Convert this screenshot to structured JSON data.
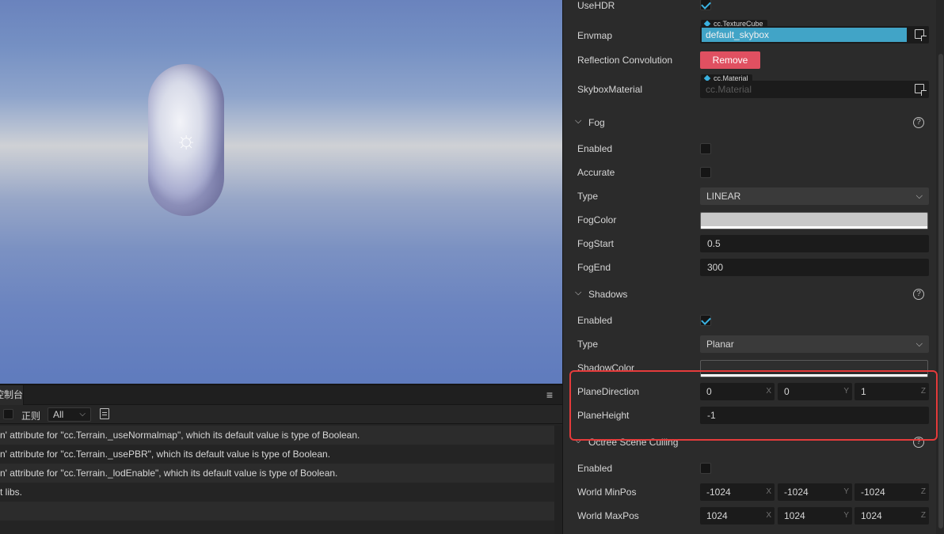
{
  "console": {
    "tab_label": "控制台",
    "regex_label": "正则",
    "filter_value": "All",
    "menu_icon": "≡",
    "logs": [
      "n' attribute for \"cc.Terrain._useNormalmap\", which its default value is type of Boolean.",
      "n' attribute for \"cc.Terrain._usePBR\", which its default value is type of Boolean.",
      "n' attribute for \"cc.Terrain._lodEnable\", which its default value is type of Boolean.",
      "t libs.",
      ""
    ]
  },
  "inspector": {
    "skybox": {
      "use_hdr_label": "UseHDR",
      "envmap_label": "Envmap",
      "envmap_type": "cc.TextureCube",
      "envmap_value": "default_skybox",
      "reflection_label": "Reflection Convolution",
      "remove_label": "Remove",
      "material_label": "SkyboxMaterial",
      "material_type": "cc.Material",
      "material_placeholder": "cc.Material"
    },
    "fog": {
      "title": "Fog",
      "enabled_label": "Enabled",
      "accurate_label": "Accurate",
      "type_label": "Type",
      "type_value": "LINEAR",
      "color_label": "FogColor",
      "start_label": "FogStart",
      "start_value": "0.5",
      "end_label": "FogEnd",
      "end_value": "300"
    },
    "shadows": {
      "title": "Shadows",
      "enabled_label": "Enabled",
      "type_label": "Type",
      "type_value": "Planar",
      "color_label": "ShadowColor",
      "plane_dir_label": "PlaneDirection",
      "plane_dir_x": "0",
      "plane_dir_y": "0",
      "plane_dir_z": "1",
      "plane_height_label": "PlaneHeight",
      "plane_height_value": "-1"
    },
    "octree": {
      "title": "Octree Scene Culling",
      "enabled_label": "Enabled",
      "min_label": "World MinPos",
      "min_x": "-1024",
      "min_y": "-1024",
      "min_z": "-1024",
      "max_label": "World MaxPos",
      "max_x": "1024",
      "max_y": "1024",
      "max_z": "1024"
    },
    "axes": {
      "x": "X",
      "y": "Y",
      "z": "Z"
    },
    "help_glyph": "?"
  },
  "colors": {
    "accent": "#3ab1e0",
    "remove": "#e05061",
    "highlight": "#e53b3b",
    "fog_color": "#c8c8c8"
  },
  "icons": {
    "light": "sun-icon",
    "picker": "asset-picker-icon",
    "help": "help-icon",
    "chevron": "chevron-down-icon"
  }
}
